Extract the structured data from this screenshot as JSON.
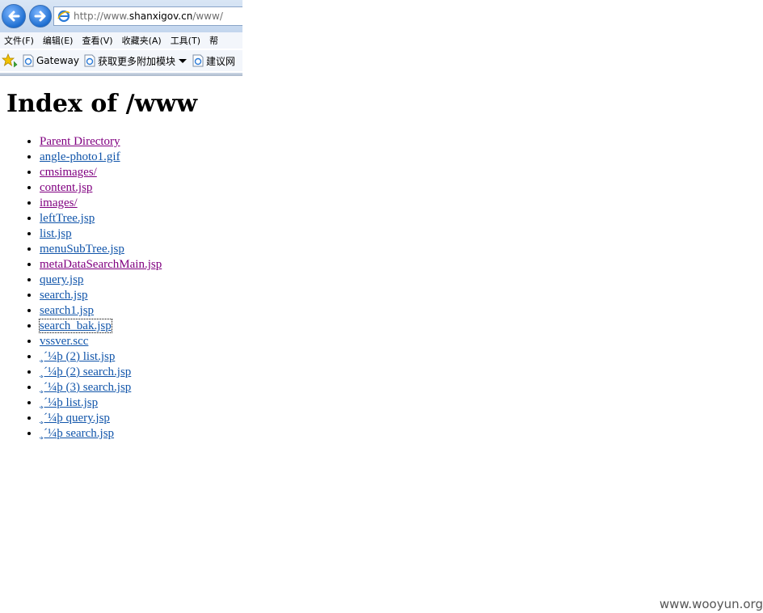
{
  "browser": {
    "address_url_prefix": "http://www.",
    "address_url_domain": "shanxigov.cn",
    "address_url_path": "/www/",
    "menu": [
      "文件(F)",
      "编辑(E)",
      "查看(V)",
      "收藏夹(A)",
      "工具(T)",
      "帮"
    ],
    "favorites": [
      "Gateway",
      "获取更多附加模块",
      "建议网"
    ]
  },
  "page": {
    "title": "Index of /www",
    "items": [
      "Parent Directory",
      "angle-photo1.gif",
      "cmsimages/",
      "content.jsp",
      "images/",
      "leftTree.jsp",
      "list.jsp",
      "menuSubTree.jsp",
      "metaDataSearchMain.jsp",
      "query.jsp",
      "search.jsp",
      "search1.jsp",
      "search_bak.jsp",
      "vssver.scc",
      "¸´¼þ (2) list.jsp",
      "¸´¼þ (2) search.jsp",
      "¸´¼þ (3) search.jsp",
      "¸´¼þ list.jsp",
      "¸´¼þ query.jsp",
      "¸´¼þ search.jsp"
    ]
  },
  "watermark": "www.wooyun.org"
}
